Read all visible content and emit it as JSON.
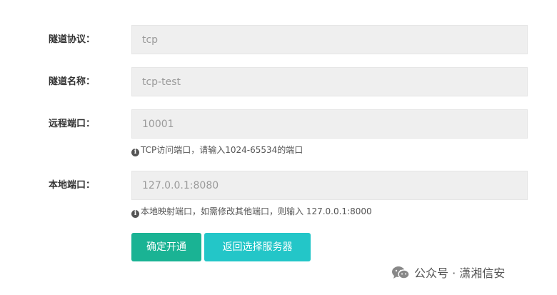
{
  "form": {
    "protocol": {
      "label": "隧道协议：",
      "value": "tcp"
    },
    "name": {
      "label": "隧道名称：",
      "value": "tcp-test"
    },
    "remote_port": {
      "label": "远程端口：",
      "value": "10001",
      "hint": "TCP访问端口，请输入1024-65534的端口"
    },
    "local_port": {
      "label": "本地端口：",
      "value": "127.0.0.1:8080",
      "hint": "本地映射端口，如需修改其他端口，则输入 127.0.0.1:8000"
    }
  },
  "buttons": {
    "confirm": "确定开通",
    "back": "返回选择服务器"
  },
  "colors": {
    "confirm_bg": "#1ab394",
    "back_bg": "#23c6c8",
    "field_bg": "#efefef"
  },
  "watermark": {
    "icon": "wechat-icon",
    "text": "公众号 · 潇湘信安"
  }
}
